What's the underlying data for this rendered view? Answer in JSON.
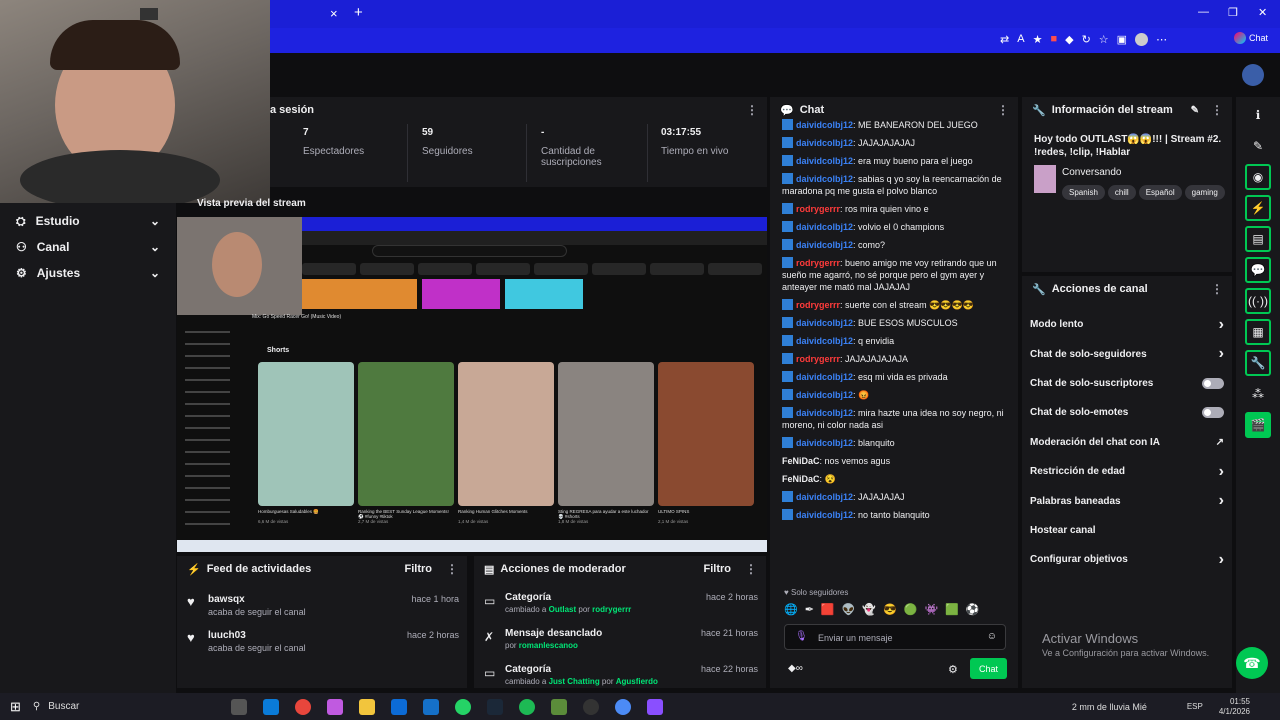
{
  "browser": {
    "tab_close": "×",
    "tab_new": "+",
    "chat_button": "Chat",
    "window_controls": [
      "—",
      "❐",
      "✕"
    ]
  },
  "left_nav": {
    "items": [
      {
        "icon": "studio-icon",
        "label": "Estudio"
      },
      {
        "icon": "channel-icon",
        "label": "Canal"
      },
      {
        "icon": "settings-icon",
        "label": "Ajustes"
      }
    ]
  },
  "session": {
    "title": "a sesión",
    "stats": [
      {
        "value": "7",
        "label": "Espectadores"
      },
      {
        "value": "59",
        "label": "Seguidores"
      },
      {
        "value": "-",
        "label": "Cantidad de suscripciones"
      },
      {
        "value": "03:17:55",
        "label": "Tiempo en vivo"
      }
    ]
  },
  "preview": {
    "title": "Vista previa del stream",
    "video_title": "Mix: Go Speed Racer Go! (Music Video)",
    "shorts_label": "Shorts",
    "shorts": [
      {
        "title": "Homburguesas Saludables 🍔",
        "views": "6,6 M de vistas"
      },
      {
        "title": "Ranking the BEST Sunday League Moments! ⚽ #funny #tiktok",
        "views": "2,7 M de vistas"
      },
      {
        "title": "Ranking Human Glitches Moments",
        "views": "1,4 M de vistas"
      },
      {
        "title": "Sting REGRESA para ayudar a este luchador 💀 #shorts",
        "views": "1,8 M de vistas"
      },
      {
        "title": "ULTIMO SPINS",
        "views": "2,1 M de vistas"
      }
    ]
  },
  "chat": {
    "title": "Chat",
    "messages": [
      {
        "user": "daividcolbj12",
        "color": "#3b82f6",
        "text": "ME BANEARON DEL JUEGO"
      },
      {
        "user": "daividcolbj12",
        "color": "#3b82f6",
        "text": "JAJAJAJAJAJ"
      },
      {
        "user": "daividcolbj12",
        "color": "#3b82f6",
        "text": "era muy bueno para el juego"
      },
      {
        "user": "daividcolbj12",
        "color": "#3b82f6",
        "text": "sabias q yo soy la reencarnación de maradona pq me gusta el polvo blanco"
      },
      {
        "user": "rodrygerrr",
        "color": "#ff3b3b",
        "text": "ros mira quien vino e"
      },
      {
        "user": "daividcolbj12",
        "color": "#3b82f6",
        "text": "volvio el 0 champions"
      },
      {
        "user": "daividcolbj12",
        "color": "#3b82f6",
        "text": "como?"
      },
      {
        "user": "rodrygerrr",
        "color": "#ff3b3b",
        "text": "bueno amigo me voy retirando que un sueño me agarró, no sé porque pero el gym ayer y anteayer me mató mal JAJAJAJ"
      },
      {
        "user": "rodrygerrr",
        "color": "#ff3b3b",
        "text": "suerte con el stream 😎😎😎😎"
      },
      {
        "user": "daividcolbj12",
        "color": "#3b82f6",
        "text": "BUE ESOS MUSCULOS"
      },
      {
        "user": "daividcolbj12",
        "color": "#3b82f6",
        "text": "q envidia"
      },
      {
        "user": "rodrygerrr",
        "color": "#ff3b3b",
        "text": "JAJAJAJAJAJA"
      },
      {
        "user": "daividcolbj12",
        "color": "#3b82f6",
        "text": "esq mi vida es privada"
      },
      {
        "user": "daividcolbj12",
        "color": "#3b82f6",
        "text": "😡"
      },
      {
        "user": "daividcolbj12",
        "color": "#3b82f6",
        "text": "mira hazte una idea no soy negro, ni moreno, ni color nada asi"
      },
      {
        "user": "daividcolbj12",
        "color": "#3b82f6",
        "text": "blanquito"
      },
      {
        "user": "FeNiDaC",
        "color": "#efeff1",
        "text": "nos vemos agus"
      },
      {
        "user": "FeNiDaC",
        "color": "#efeff1",
        "text": "😵"
      },
      {
        "user": "daividcolbj12",
        "color": "#3b82f6",
        "text": "JAJAJAJAJ"
      },
      {
        "user": "daividcolbj12",
        "color": "#3b82f6",
        "text": "no tanto blanquito"
      }
    ],
    "followers_only": "Solo seguidores",
    "input_placeholder": "Enviar un mensaje",
    "send_label": "Chat"
  },
  "stream_info": {
    "title": "Información del stream",
    "stream_title": "Hoy todo OUTLAST😱😱!!! | Stream #2. !redes, !clip, !Hablar",
    "category": "Conversando",
    "tags": [
      "Spanish",
      "chill",
      "Español",
      "gaming"
    ]
  },
  "channel_actions": {
    "title": "Acciones de canal",
    "items": [
      {
        "label": "Modo lento",
        "control": "chevron"
      },
      {
        "label": "Chat de solo-seguidores",
        "control": "chevron"
      },
      {
        "label": "Chat de solo-suscriptores",
        "control": "toggle"
      },
      {
        "label": "Chat de solo-emotes",
        "control": "toggle"
      },
      {
        "label": "Moderación del chat con IA",
        "control": "external"
      },
      {
        "label": "Restricción de edad",
        "control": "chevron"
      },
      {
        "label": "Palabras baneadas",
        "control": "chevron"
      },
      {
        "label": "Hostear canal",
        "control": "none"
      },
      {
        "label": "Configurar objetivos",
        "control": "chevron"
      }
    ]
  },
  "activity_feed": {
    "title": "Feed de actividades",
    "filter": "Filtro",
    "items": [
      {
        "user": "bawsqx",
        "action": "acaba de seguir el canal",
        "time": "hace 1 hora"
      },
      {
        "user": "luuch03",
        "action": "acaba de seguir el canal",
        "time": "hace 2 horas"
      }
    ]
  },
  "mod_actions": {
    "title": "Acciones de moderador",
    "filter": "Filtro",
    "items": [
      {
        "title": "Categoría",
        "detail_prefix": "cambiado a ",
        "detail_value": "Outlast",
        "detail_by": " por ",
        "detail_user": "rodrygerrr",
        "time": "hace 2 horas"
      },
      {
        "title": "Mensaje desanclado",
        "detail_prefix": "por ",
        "detail_value": "",
        "detail_by": "",
        "detail_user": "romanlescanoo",
        "time": "hace 21 horas"
      },
      {
        "title": "Categoría",
        "detail_prefix": "cambiado a ",
        "detail_value": "Just Chatting",
        "detail_by": " por ",
        "detail_user": "Agusfierdo",
        "time": "hace 22 horas"
      }
    ]
  },
  "windows": {
    "activate_title": "Activar Windows",
    "activate_sub": "Ve a Configuración para activar Windows."
  },
  "taskbar": {
    "search": "Buscar",
    "weather": "2 mm de lluvia Mié",
    "lang": "ESP",
    "time": "01:55",
    "date": "4/1/2026"
  }
}
